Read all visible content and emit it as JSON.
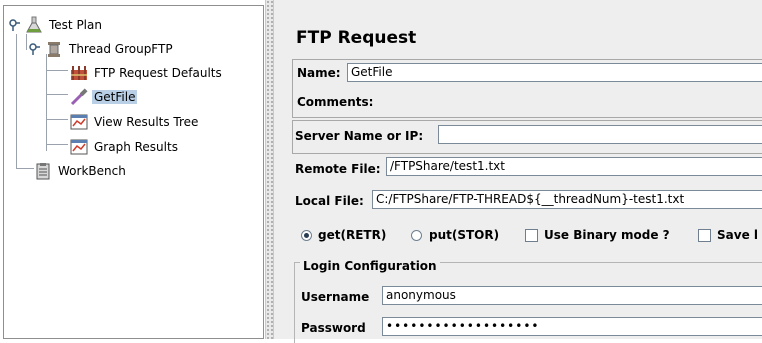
{
  "tree": {
    "items": [
      {
        "label": "Test Plan",
        "icon": "flask-icon"
      },
      {
        "label": "Thread GroupFTP",
        "icon": "spool-icon"
      },
      {
        "label": "FTP Request Defaults",
        "icon": "defaults-icon"
      },
      {
        "label": "GetFile",
        "icon": "dropper-icon"
      },
      {
        "label": "View Results Tree",
        "icon": "chart-icon"
      },
      {
        "label": "Graph Results",
        "icon": "chart-icon"
      },
      {
        "label": "WorkBench",
        "icon": "clipboard-icon"
      }
    ]
  },
  "form": {
    "title": "FTP Request",
    "name_label": "Name:",
    "name_value": "GetFile",
    "comments_label": "Comments:",
    "server_label": "Server Name or IP:",
    "server_value": "",
    "remote_label": "Remote File:",
    "remote_value": "/FTPShare/test1.txt",
    "local_label": "Local File:",
    "local_value": "C:/FTPShare/FTP-THREAD${__threadNum}-test1.txt",
    "get_label": "get(RETR)",
    "put_label": "put(STOR)",
    "binary_label": "Use Binary mode ?",
    "save_label": "Save l",
    "login_legend": "Login Configuration",
    "username_label": "Username",
    "username_value": "anonymous",
    "password_label": "Password",
    "password_value": "•••••••••••••••••••"
  },
  "colors": {
    "selection": "#b8cfe5",
    "panel_bg": "#eeeeee",
    "radio_dot": "#2b3c52"
  }
}
